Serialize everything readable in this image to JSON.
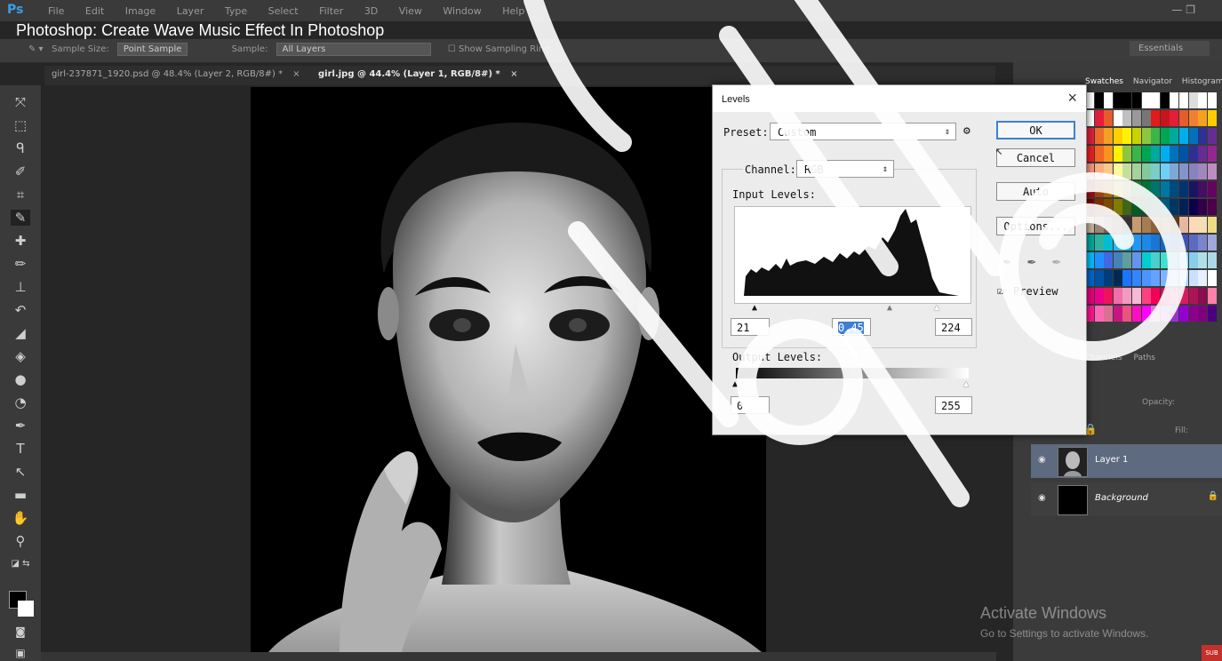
{
  "video_title": "Photoshop: Create Wave Music Effect In Photoshop",
  "app": {
    "logo": "Ps",
    "menu": [
      "File",
      "Edit",
      "Image",
      "Layer",
      "Type",
      "Select",
      "Filter",
      "3D",
      "View",
      "Window",
      "Help"
    ],
    "window_controls": "— ❐"
  },
  "options_bar": {
    "sample_size_label": "Sample Size:",
    "sample_size_value": "Point Sample",
    "sample_label": "Sample:",
    "sample_value": "All Layers",
    "show_ring_label": "Show Sampling Ring",
    "workspace": "Essentials"
  },
  "doc_tabs": [
    {
      "label": "girl-237871_1920.psd @ 48.4% (Layer 2, RGB/8#) *"
    },
    {
      "label": "girl.jpg @ 44.4% (Layer 1, RGB/8#) *"
    }
  ],
  "levels_dialog": {
    "title": "Levels",
    "preset_label": "Preset:",
    "preset_value": "Custom",
    "channel_label": "Channel:",
    "channel_value": "RGB",
    "input_levels_label": "Input Levels:",
    "input_black": "21",
    "input_gamma": "0.45",
    "input_white": "224",
    "output_levels_label": "Output Levels:",
    "output_black": "0",
    "output_white": "255",
    "buttons": {
      "ok": "OK",
      "cancel": "Cancel",
      "auto": "Auto",
      "options": "Options..."
    },
    "preview_label": "Preview",
    "preview_checked": true
  },
  "swatches_tabs": [
    "Swatches",
    "Navigator",
    "Histogram"
  ],
  "layers_panel": {
    "tabs": [
      "Channels",
      "Paths"
    ],
    "opacity_label": "Opacity:",
    "fill_label": "Fill:",
    "layers": [
      {
        "name": "Layer 1",
        "selected": true
      },
      {
        "name": "Background",
        "selected": false
      }
    ]
  },
  "activate_windows": {
    "title": "Activate Windows",
    "subtitle": "Go to Settings to activate Windows."
  },
  "subscribe_label": "SUB",
  "colors": {
    "accent": "#3c7fd4",
    "layer_selected": "#5d6a7f",
    "ps_blue": "#3aa0e8"
  }
}
